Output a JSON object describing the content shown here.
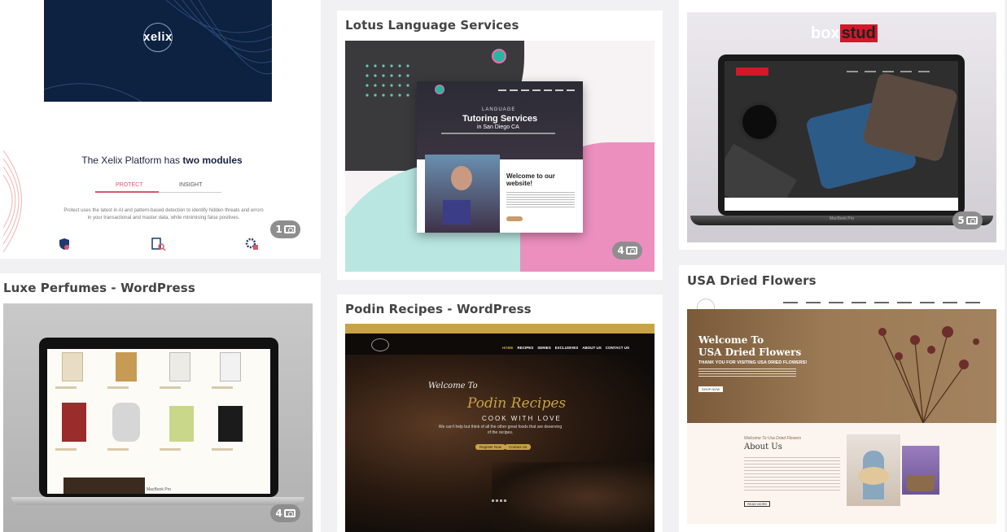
{
  "cards": {
    "xelix": {
      "logo_text": "xelix",
      "platform_heading_prefix": "The Xelix Platform has ",
      "platform_heading_bold": "two modules",
      "tab_protect": "PROTECT",
      "tab_insight": "INSIGHT",
      "description": "Protect uses the latest in AI and pattern-based detection to identify hidden threats and errors in your transactional and master data, while minimising false positives.",
      "photo_count": "1"
    },
    "luxe": {
      "title": "Luxe Perfumes - WordPress",
      "photo_count": "4",
      "laptop_label": "MacBook Pro"
    },
    "lotus": {
      "title": "Lotus Language Services",
      "hero_small": "LANGUAGE",
      "hero_big": "Tutoring Services",
      "hero_city": "in San Diego CA",
      "welcome_heading": "Welcome to our website!",
      "photo_count": "4"
    },
    "podin": {
      "title": "Podin Recipes - WordPress",
      "nav_items": [
        "HOME",
        "RECIPES",
        "SERIES",
        "EXCLUSIVES",
        "ABOUT US",
        "CONTACT US"
      ],
      "welcome": "Welcome To",
      "brand": "Podin Recipes",
      "tagline": "COOK WITH LOVE",
      "blurb": "We can't help but think of all the other great foods that are deserving of the recipes.",
      "btn_register": "Register Now",
      "btn_contact": "Contact Us"
    },
    "boxstud": {
      "logo_box": "box",
      "logo_stud": "stud",
      "photo_count": "5",
      "laptop_label": "MacBook Pro"
    },
    "dried": {
      "title": "USA Dried Flowers",
      "hero_title_1": "Welcome To",
      "hero_title_2": "USA Dried Flowers",
      "hero_sub": "THANK YOU FOR VISITING USA DRIED FLOWERS!",
      "shop_btn": "SHOP NOW",
      "about_kicker": "Welcome To Usa Dried Flowers",
      "about_title": "About Us",
      "read_more": "READ MORE"
    }
  },
  "colors": {
    "page_bg": "#f1f1f3",
    "card_bg": "#ffffff",
    "title_text": "#444444",
    "badge_bg": "#8e8e8e",
    "xelix_navy": "#0d2140",
    "lotus_mint": "#b9e6e0",
    "lotus_pink": "#ec8fbf",
    "podin_gold": "#c8a247",
    "boxstud_red": "#d3182a",
    "dried_hero": "#8f6a48"
  }
}
